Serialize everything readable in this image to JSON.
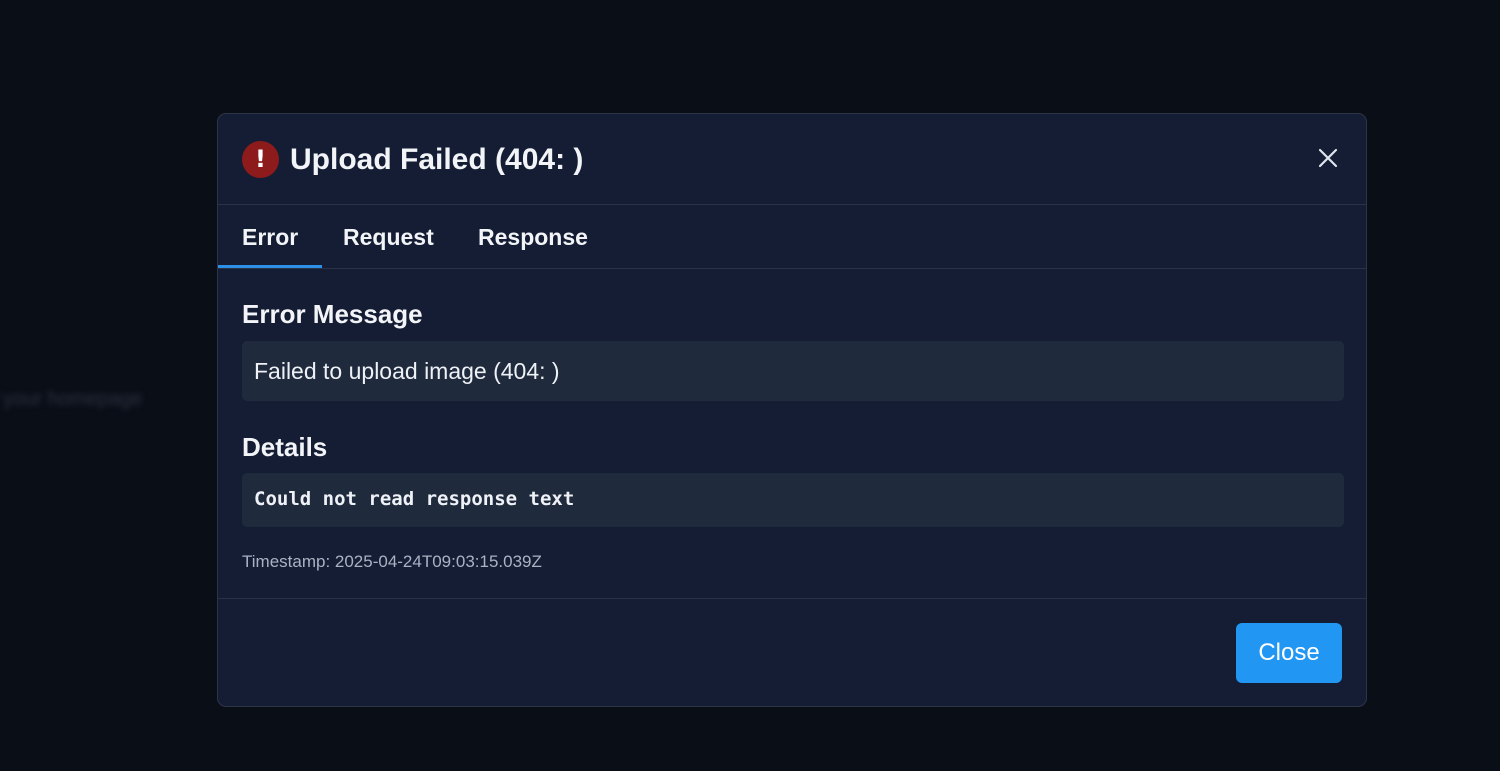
{
  "background": {
    "text": "f your homepage"
  },
  "dialog": {
    "title": "Upload Failed (404: )",
    "icon": "error-icon",
    "close_icon": "close-icon",
    "tabs": [
      {
        "label": "Error",
        "active": true
      },
      {
        "label": "Request",
        "active": false
      },
      {
        "label": "Response",
        "active": false
      }
    ],
    "error_message": {
      "heading": "Error Message",
      "text": "Failed to upload image (404: )"
    },
    "details": {
      "heading": "Details",
      "text": "Could not read response text"
    },
    "timestamp": "Timestamp: 2025-04-24T09:03:15.039Z",
    "close_button_label": "Close"
  },
  "colors": {
    "accent": "#2196f3",
    "error_icon_bg": "#8e1b1b",
    "dialog_bg": "#141d33",
    "box_bg": "#1f2a3c"
  }
}
